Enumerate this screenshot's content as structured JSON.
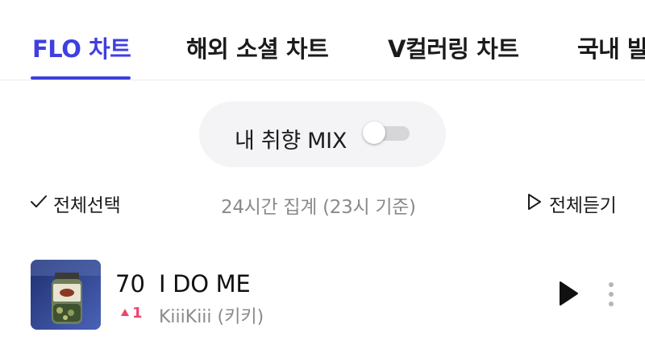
{
  "tabs": [
    {
      "label": "FLO 차트",
      "active": true
    },
    {
      "label": "해외 소셜 차트",
      "active": false
    },
    {
      "label": "V컬러링 차트",
      "active": false
    },
    {
      "label": "국내 발",
      "active": false
    }
  ],
  "mix": {
    "label": "내 취향 MIX",
    "toggle_on": false
  },
  "controls": {
    "select_all_label": "전체선택",
    "aggregate_text": "24시간 집계 (23시 기준)",
    "play_all_label": "전체듣기"
  },
  "track": {
    "rank": "70",
    "title": "I DO ME",
    "rank_change": "1",
    "rank_direction": "up",
    "artist": "KiiiKiii (키키)",
    "album_art_icon": "album-cover"
  },
  "colors": {
    "accent": "#3f3fe0",
    "rank_up": "#f0446e",
    "muted_text": "#8a8a8e",
    "pill_bg": "#f4f4f6"
  }
}
